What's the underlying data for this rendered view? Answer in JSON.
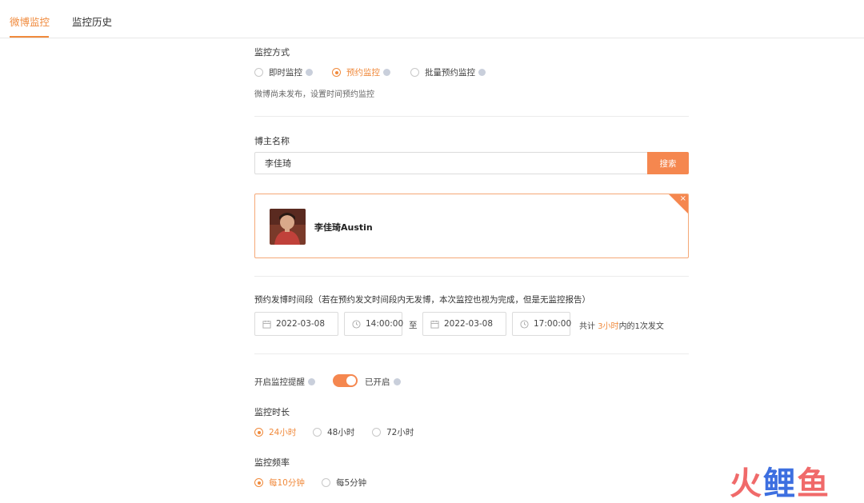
{
  "tabs": [
    {
      "label": "微博监控",
      "active": true
    },
    {
      "label": "监控历史",
      "active": false
    }
  ],
  "monitor_mode": {
    "label": "监控方式",
    "options": [
      "即时监控",
      "预约监控",
      "批量预约监控"
    ],
    "selected": "预约监控",
    "hint": "微博尚未发布，设置时间预约监控"
  },
  "blogger": {
    "label": "博主名称",
    "input_value": "李佳琦",
    "search_label": "搜索",
    "result_name": "李佳琦Austin",
    "close_glyph": "×"
  },
  "schedule": {
    "label": "预约发博时间段（若在预约发文时间段内无发博，本次监控也视为完成，但是无监控报告）",
    "start_date": "2022-03-08",
    "start_time": "14:00:00",
    "to_label": "至",
    "end_date": "2022-03-08",
    "end_time": "17:00:00",
    "summary_prefix": "共计",
    "summary_hours": "3小时",
    "summary_suffix": "内的1次发文"
  },
  "reminder": {
    "label": "开启监控提醒",
    "status": "已开启",
    "enabled": true
  },
  "duration": {
    "label": "监控时长",
    "options": [
      "24小时",
      "48小时",
      "72小时"
    ],
    "selected": "24小时"
  },
  "frequency": {
    "label": "监控频率",
    "options": [
      "每10分钟",
      "每5分钟"
    ],
    "selected": "每10分钟"
  },
  "watermark": {
    "char1": "火",
    "char2": "鲤",
    "char3": "鱼"
  },
  "colors": {
    "accent": "#f08a3c",
    "button": "#f5874f",
    "border": "#dcdcdc"
  }
}
